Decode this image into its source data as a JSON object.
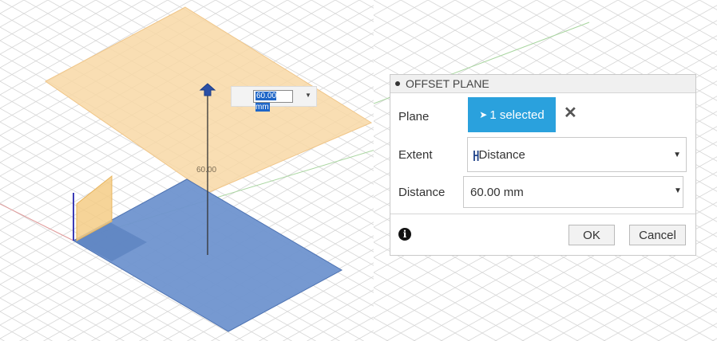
{
  "canvas_left": {
    "distance_input_value": "60.00 mm",
    "dimension_label": "60.00"
  },
  "dialog": {
    "title": "OFFSET PLANE",
    "plane_label": "Plane",
    "plane_selection": "1 selected",
    "extent_label": "Extent",
    "extent_value": "Distance",
    "distance_label": "Distance",
    "distance_value": "60.00 mm",
    "ok_label": "OK",
    "cancel_label": "Cancel"
  },
  "colors": {
    "selection_blue": "#2aa1dd",
    "offset_plane": "#f8d8a6",
    "base_plane": "#6f94cf"
  }
}
